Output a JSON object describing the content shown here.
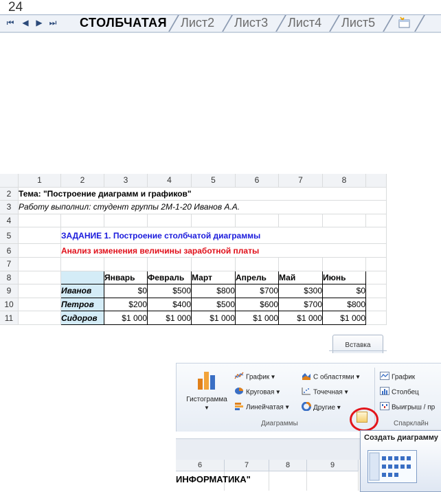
{
  "sheet_tabs": {
    "row_number": "24",
    "active": "СТОЛБЧАТАЯ",
    "others": [
      "Лист2",
      "Лист3",
      "Лист4",
      "Лист5"
    ]
  },
  "sheet": {
    "col_headers": [
      "1",
      "2",
      "3",
      "4",
      "5",
      "6",
      "7",
      "8"
    ],
    "row_numbers": [
      "2",
      "3",
      "4",
      "5",
      "6",
      "7",
      "8",
      "9",
      "10",
      "11"
    ],
    "title": "Тема: \"Построение диаграмм и графиков\"",
    "author": "Работу выполнил: студент группы 2М-1-20 Иванов А.А.",
    "task": "ЗАДАНИЕ 1. Построение столбчатой диаграммы",
    "subtitle": "Анализ изменения величины заработной платы",
    "table": {
      "months": [
        "Январь",
        "Февраль",
        "Март",
        "Апрель",
        "Май",
        "Июнь"
      ],
      "rows": [
        {
          "name": "Иванов",
          "values": [
            "$0",
            "$500",
            "$800",
            "$700",
            "$300",
            "$0"
          ]
        },
        {
          "name": "Петров",
          "values": [
            "$200",
            "$400",
            "$500",
            "$600",
            "$700",
            "$800"
          ]
        },
        {
          "name": "Сидоров",
          "values": [
            "$1 000",
            "$1 000",
            "$1 000",
            "$1 000",
            "$1 000",
            "$1 000"
          ]
        }
      ]
    }
  },
  "ribbon": {
    "tab": "Вставка",
    "histogram": "Гистограмма",
    "items": {
      "graph": "График ▾",
      "pie": "Круговая ▾",
      "linear": "Линейчатая ▾",
      "area": "С областями ▾",
      "scatter": "Точечная ▾",
      "other": "Другие ▾",
      "sp_graph": "График",
      "sp_column": "Столбец",
      "sp_winloss": "Выигрыш / пр"
    },
    "group_charts": "Диаграммы",
    "group_sparklines": "Спарклайн"
  },
  "lower_sheet": {
    "col_headers": [
      "6",
      "7",
      "8",
      "9"
    ],
    "text": "ИНФОРМАТИКА\""
  },
  "tooltip": {
    "title": "Создать диаграмму"
  },
  "colors": {
    "task_blue": "#1a1adc",
    "subtitle_red": "#e0101a",
    "table_fill": "#d4ecf7",
    "highlight_circle": "#e3151b"
  }
}
